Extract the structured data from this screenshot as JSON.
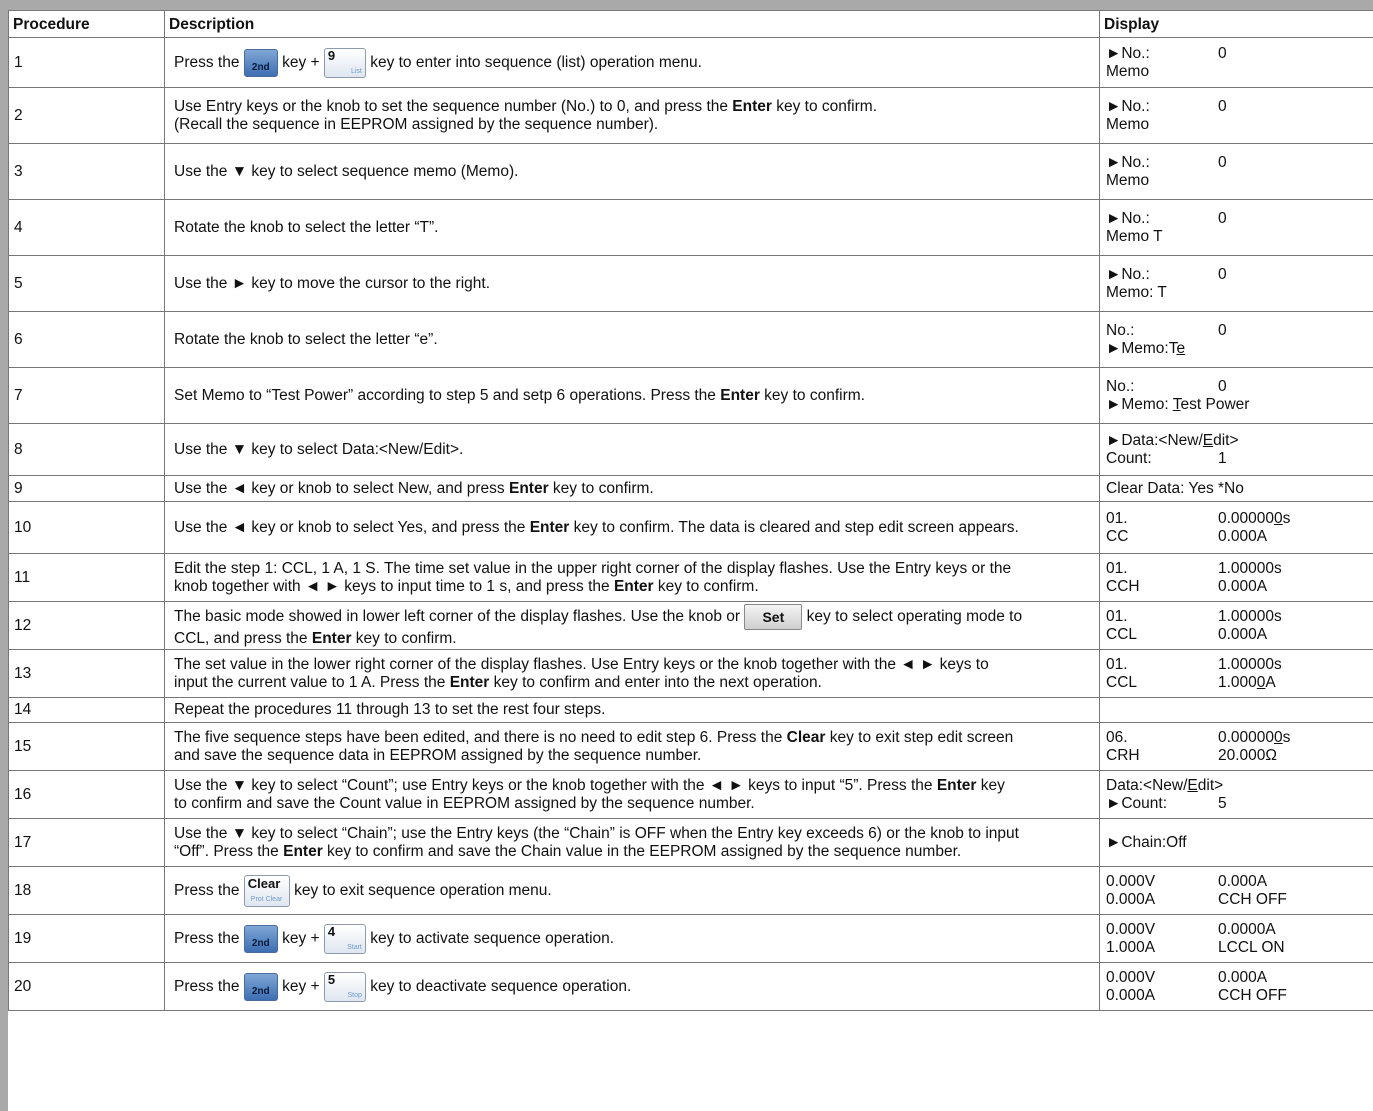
{
  "header": {
    "procedure": "Procedure",
    "description": "Description",
    "display": "Display"
  },
  "keys": {
    "second": "2nd",
    "nine": "9",
    "nine_sub": "List",
    "four": "4",
    "four_sub": "Start",
    "five": "5",
    "five_sub": "Stop",
    "set": "Set",
    "clear": "Clear",
    "clear_sub": "Prot Clear"
  },
  "rows": [
    {
      "num": "1",
      "t": [
        "Press the ",
        "key + ",
        "key to enter into sequence (list) operation menu."
      ],
      "d": [
        [
          "►No.:",
          "0"
        ],
        [
          "Memo",
          ""
        ]
      ]
    },
    {
      "num": "2",
      "t": [
        "Use Entry keys or the knob to set the sequence number (No.) to 0, and press the ",
        "Enter",
        " key to confirm.",
        "(Recall the sequence in EEPROM assigned by the sequence number)."
      ],
      "d": [
        [
          "►No.:",
          "0"
        ],
        [
          "Memo",
          ""
        ]
      ]
    },
    {
      "num": "3",
      "t": [
        "Use the ▼ key to select sequence memo (Memo)."
      ],
      "d": [
        [
          "►No.:",
          "0"
        ],
        [
          "Memo",
          ""
        ]
      ]
    },
    {
      "num": "4",
      "t": [
        "Rotate the knob to select the letter “T”."
      ],
      "d": [
        [
          "►No.:",
          "0"
        ],
        [
          "Memo T",
          ""
        ]
      ]
    },
    {
      "num": "5",
      "t": [
        "Use the ► key to move the cursor to the right."
      ],
      "d": [
        [
          "►No.:",
          "0"
        ],
        [
          "Memo: T",
          ""
        ]
      ]
    },
    {
      "num": "6",
      "t": [
        "Rotate the knob to select the letter “e”."
      ],
      "d": [
        [
          "No.:",
          "0"
        ],
        [
          "►Memo:T",
          "e"
        ]
      ]
    },
    {
      "num": "7",
      "t": [
        "Set Memo to “Test Power” according to step 5 and setp 6 operations. Press the ",
        "Enter",
        " key to confirm."
      ],
      "d": [
        [
          "No.:",
          "0"
        ],
        [
          "►Memo: ",
          "T",
          "est Power"
        ]
      ]
    },
    {
      "num": "8",
      "t": [
        "Use the ▼ key to select Data:<New/Edit>."
      ],
      "d": [
        [
          "►Data:<New/",
          "E",
          "dit>"
        ],
        [
          "Count:",
          "1"
        ]
      ]
    },
    {
      "num": "9",
      "t": [
        "Use the ◄ key or knob to select New, and press ",
        "Enter",
        " key to confirm."
      ],
      "d": [
        [
          "Clear Data: Yes *No",
          ""
        ]
      ]
    },
    {
      "num": "10",
      "t": [
        "Use the ◄ key or knob to select Yes, and press the ",
        "Enter",
        " key to confirm. The data is cleared and step edit screen appears."
      ],
      "d": [
        [
          "01.",
          "0.00000",
          "0",
          "s"
        ],
        [
          "CC",
          "0.000A"
        ]
      ]
    },
    {
      "num": "11",
      "t": [
        "Edit the step 1: CCL, 1 A, 1 S. The time set value in the upper right corner of the display flashes. Use the Entry keys or the",
        "knob together with ◄ ► keys to input time to 1 s, and press the ",
        "Enter",
        " key to confirm."
      ],
      "d": [
        [
          "01.",
          "1.00000s"
        ],
        [
          "CCH",
          "0.000A"
        ]
      ]
    },
    {
      "num": "12",
      "t": [
        "The basic mode showed in lower left corner of the display flashes. Use the knob or ",
        "key to select operating mode to",
        "CCL, and press the ",
        "Enter",
        " key to confirm."
      ],
      "d": [
        [
          "01.",
          "1.00000s"
        ],
        [
          "CCL",
          "0.000A"
        ]
      ]
    },
    {
      "num": "13",
      "t": [
        "The set value in the lower right corner of the display flashes. Use Entry keys or the knob together with the ◄ ► keys to",
        "input the current value to 1 A. Press the ",
        "Enter",
        " key to confirm and enter into the next operation."
      ],
      "d": [
        [
          "01.",
          "1.00000s"
        ],
        [
          "CCL",
          "1.000",
          "0",
          "A"
        ]
      ]
    },
    {
      "num": "14",
      "t": [
        "Repeat the procedures 11 through 13 to set the rest four steps."
      ],
      "d": []
    },
    {
      "num": "15",
      "t": [
        "The five sequence steps have been edited, and there is no need to edit step 6. Press the ",
        "Clear",
        " key to exit step edit screen",
        "and save the sequence data in EEPROM assigned by the sequence number."
      ],
      "d": [
        [
          "06.",
          "0.00000",
          "0",
          "s"
        ],
        [
          "CRH",
          "20.000Ω"
        ]
      ]
    },
    {
      "num": "16",
      "t": [
        "Use the ▼ key to select “Count”; use Entry keys or the knob together with the ◄ ► keys to input “5”. Press the ",
        "Enter",
        " key",
        "to confirm and save the Count value in EEPROM assigned by the sequence number."
      ],
      "d": [
        [
          "Data:<New/",
          "E",
          "dit>"
        ],
        [
          "►Count:",
          "5"
        ]
      ]
    },
    {
      "num": "17",
      "t": [
        "Use the ▼ key to select “Chain”; use the Entry keys (the “Chain” is OFF when the Entry key exceeds 6) or the knob to input",
        "“Off”. Press the ",
        "Enter",
        " key to confirm and save the Chain value in the EEPROM assigned by the sequence number."
      ],
      "d": [
        [
          "►Chain:Off",
          ""
        ]
      ]
    },
    {
      "num": "18",
      "t": [
        "Press the ",
        "key to exit sequence operation menu."
      ],
      "d": [
        [
          "0.000V",
          "0.000A"
        ],
        [
          "0.000A",
          "CCH OFF"
        ]
      ]
    },
    {
      "num": "19",
      "t": [
        "Press the ",
        "key + ",
        "key to activate sequence operation."
      ],
      "d": [
        [
          "0.000V",
          "0.0000A"
        ],
        [
          "1.000A",
          "LCCL ON"
        ]
      ]
    },
    {
      "num": "20",
      "t": [
        "Press the ",
        "key + ",
        "key to deactivate sequence operation."
      ],
      "d": [
        [
          "0.000V",
          "0.000A"
        ],
        [
          "0.000A",
          "CCH OFF"
        ]
      ]
    }
  ]
}
